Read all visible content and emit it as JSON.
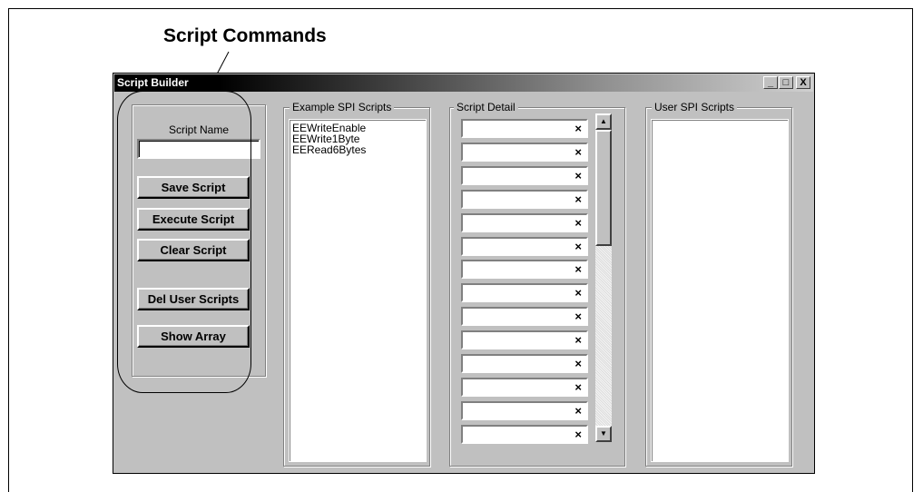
{
  "annotation": {
    "label": "Script Commands"
  },
  "window": {
    "title": "Script Builder",
    "controls": {
      "minimize": "_",
      "maximize": "□",
      "close": "X"
    }
  },
  "commands": {
    "script_name_label": "Script Name",
    "script_name_value": "",
    "buttons": [
      "Save Script",
      "Execute Script",
      "Clear Script",
      "Del User Scripts",
      "Show Array"
    ]
  },
  "example_scripts": {
    "label": "Example SPI Scripts",
    "items": [
      "EEWriteEnable",
      "EEWrite1Byte",
      "EERead6Bytes"
    ]
  },
  "script_detail": {
    "label": "Script Detail",
    "row_marker": "×",
    "rows": 14
  },
  "user_scripts": {
    "label": "User SPI Scripts",
    "items": []
  }
}
